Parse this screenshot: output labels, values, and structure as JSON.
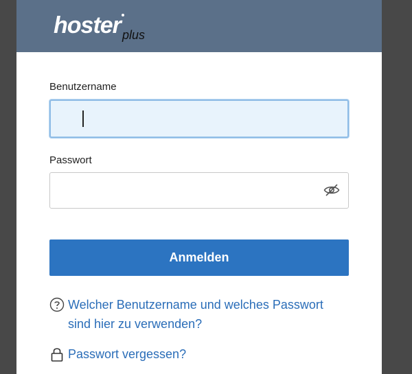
{
  "header": {
    "logo_main": "hoster",
    "logo_sub": "plus",
    "logo_icon": "hosterplus-logo"
  },
  "form": {
    "username_label": "Benutzername",
    "username_value": "",
    "password_label": "Passwort",
    "password_value": "",
    "toggle_icon": "eye-off-icon",
    "submit_label": "Anmelden"
  },
  "links": {
    "help_icon": "question-circle-icon",
    "help_text": "Welcher Benutzername und welches Passwort sind hier zu verwenden?",
    "lock_icon": "lock-icon",
    "forgot_text": "Passwort vergessen?"
  },
  "colors": {
    "header_bg": "#5b7089",
    "primary": "#2c74c1",
    "link": "#2a6db8",
    "focus_bg": "#e8f3fc",
    "backdrop": "#484848"
  }
}
